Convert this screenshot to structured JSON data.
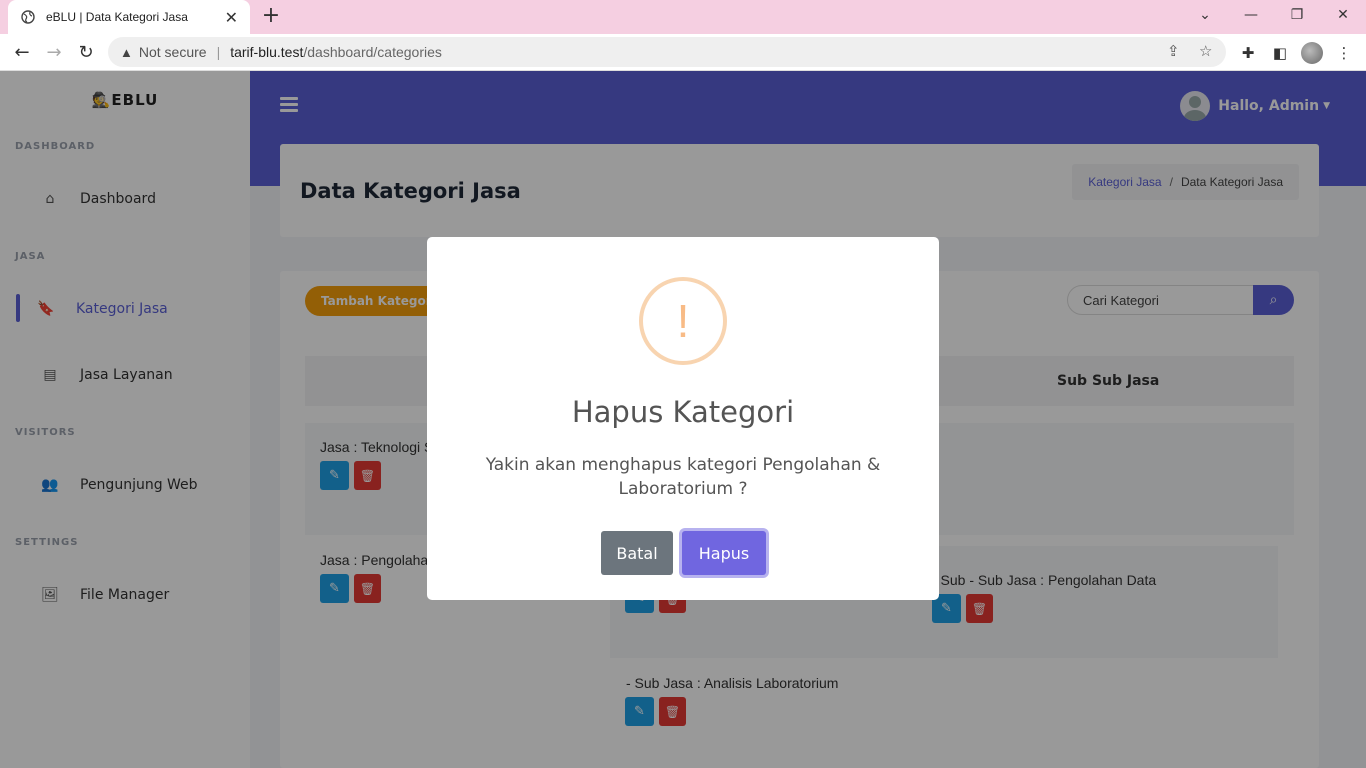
{
  "browser": {
    "tab_title": "eBLU | Data Kategori Jasa",
    "not_secure": "Not secure",
    "host": "tarif-blu.test",
    "path": "/dashboard/categories"
  },
  "sidebar": {
    "brand": "EBLU",
    "sections": {
      "dashboard": "DASHBOARD",
      "jasa": "JASA",
      "visitors": "VISITORS",
      "settings": "SETTINGS"
    },
    "items": {
      "dashboard": "Dashboard",
      "kategori_jasa": "Kategori Jasa",
      "jasa_layanan": "Jasa Layanan",
      "pengunjung_web": "Pengunjung Web",
      "file_manager": "File Manager"
    }
  },
  "topbar": {
    "greeting": "Hallo, Admin"
  },
  "header": {
    "title": "Data Kategori Jasa",
    "breadcrumb": {
      "link": "Kategori Jasa",
      "separator": "/",
      "current": "Data Kategori Jasa"
    }
  },
  "content": {
    "add_button": "Tambah Kategori I",
    "search_placeholder": "Cari Kategori",
    "col_sub_sub_jasa": "Sub Sub Jasa",
    "row1_label": "Jasa : Teknologi S",
    "row2_label": "Jasa : Pengolahan",
    "subsub_label": "- Sub - Sub Jasa : Pengolahan Data",
    "sub_label_2": "- Sub Jasa : Analisis Laboratorium"
  },
  "modal": {
    "icon": "!",
    "title": "Hapus Kategori",
    "text": "Yakin akan menghapus kategori Pengolahan & Laboratorium ?",
    "cancel": "Batal",
    "confirm": "Hapus"
  },
  "colors": {
    "primary": "#5a5fd6",
    "warning": "#f59e0b",
    "info": "#1ea1e6",
    "danger": "#e53935",
    "modal_confirm": "#7066e0",
    "modal_cancel": "#6c757d"
  }
}
